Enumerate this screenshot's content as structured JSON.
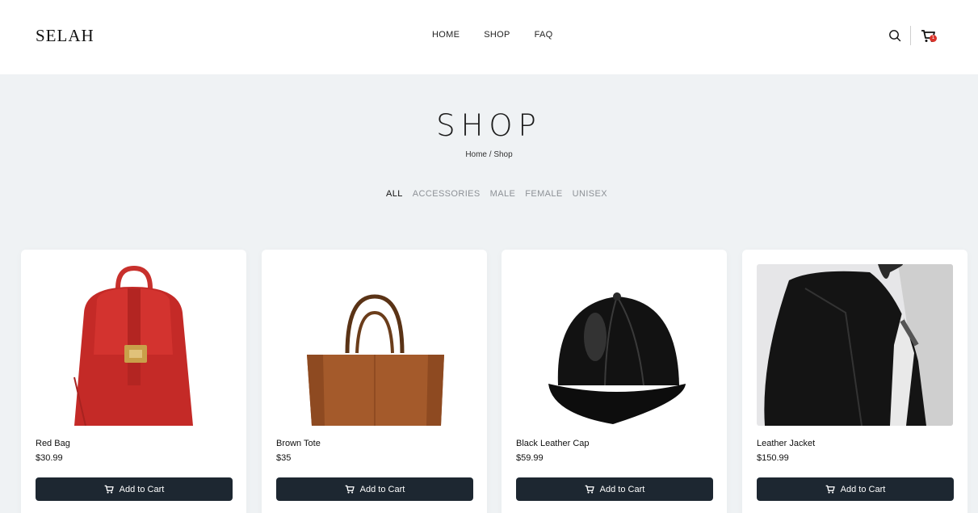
{
  "header": {
    "logo": "SELAH",
    "nav": [
      "HOME",
      "SHOP",
      "FAQ"
    ],
    "cart_count": "1",
    "icons": [
      "search-icon",
      "cart-icon"
    ]
  },
  "hero": {
    "title": "SHOP",
    "breadcrumb": "Home / Shop"
  },
  "filters": [
    "ALL",
    "ACCESSORIES",
    "MALE",
    "FEMALE",
    "UNISEX"
  ],
  "active_filter": "ALL",
  "products": [
    {
      "name": "Red Bag",
      "price": "$30.99",
      "button": "Add to Cart"
    },
    {
      "name": "Brown Tote",
      "price": "$35",
      "button": "Add to Cart"
    },
    {
      "name": "Black Leather Cap",
      "price": "$59.99",
      "button": "Add to Cart"
    },
    {
      "name": "Leather Jacket",
      "price": "$150.99",
      "button": "Add to Cart"
    }
  ],
  "colors": {
    "button_bg": "#1d2731",
    "page_bg": "#eff2f4",
    "badge": "#d9342b"
  }
}
